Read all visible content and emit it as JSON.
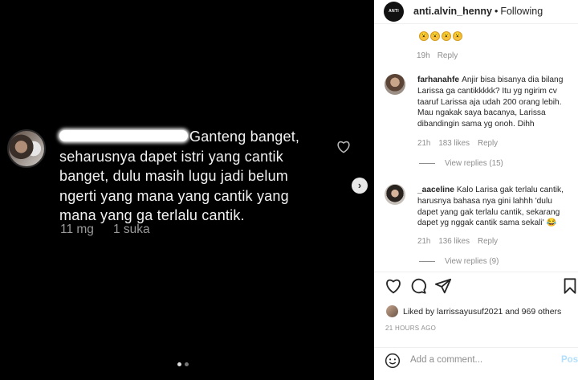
{
  "media": {
    "comment_text": "Ganteng banget, seharusnya dapet istri yang cantik banget, dulu masih lugu jadi belum ngerti yang mana yang cantik yang mana yang ga terlalu cantik.",
    "time": "11 mg",
    "likes": "1 suka",
    "next_glyph": "›"
  },
  "header": {
    "avatar_text": "ANTI",
    "username": "anti.alvin_henny",
    "separator": "•",
    "status": "Following"
  },
  "first_comment": {
    "emoji": [
      "😮",
      "😮",
      "😮",
      "😮"
    ],
    "time": "19h",
    "reply": "Reply"
  },
  "comments": [
    {
      "user": "farhanahfe",
      "text": "Anjir bisa bisanya dia bilang Larissa ga cantikkkkk? Itu yg ngirim cv taaruf Larissa aja udah 200 orang lebih. Mau ngakak saya bacanya, Larissa dibandingin sama yg onoh. Dihh",
      "time": "21h",
      "likes": "183 likes",
      "reply": "Reply",
      "view_replies": "View replies (15)"
    },
    {
      "user": "_aaceline",
      "text": "Kalo Larisa gak terlalu cantik, harusnya bahasa nya gini lahhh 'dulu dapet yang gak terlalu cantik, sekarang dapet yg nggak cantik sama sekali' 😂",
      "time": "21h",
      "likes": "136 likes",
      "reply": "Reply",
      "view_replies": "View replies (9)"
    }
  ],
  "liked_by": "Liked by larrissayusuf2021 and 969 others",
  "timestamp": "21 HOURS AGO",
  "add_comment": {
    "placeholder": "Add a comment...",
    "post_label": "Post"
  },
  "colors": {
    "post_button": "#b2dffc",
    "muted_text": "#8e8e8e"
  }
}
